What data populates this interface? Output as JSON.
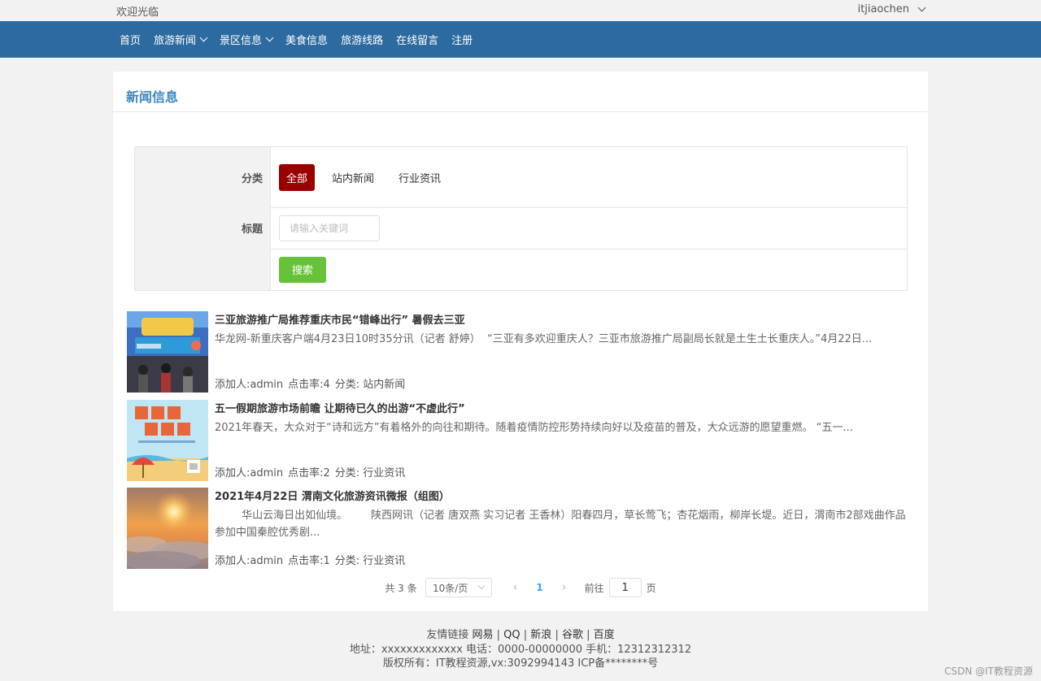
{
  "topbar": {
    "welcome": "欢迎光临",
    "username": "itjiaochen"
  },
  "nav": {
    "items": [
      {
        "label": "首页",
        "has_dropdown": false
      },
      {
        "label": "旅游新闻",
        "has_dropdown": true
      },
      {
        "label": "景区信息",
        "has_dropdown": true
      },
      {
        "label": "美食信息",
        "has_dropdown": false
      },
      {
        "label": "旅游线路",
        "has_dropdown": false
      },
      {
        "label": "在线留言",
        "has_dropdown": false
      },
      {
        "label": "注册",
        "has_dropdown": false
      }
    ]
  },
  "page": {
    "title": "新闻信息"
  },
  "filter": {
    "category_label": "分类",
    "categories": [
      "全部",
      "站内新闻",
      "行业资讯"
    ],
    "active_category": "全部",
    "title_label": "标题",
    "keyword_placeholder": "请输入关键词",
    "search_button": "搜索"
  },
  "news": [
    {
      "title": "三亚旅游推广局推荐重庆市民“错峰出行” 暑假去三亚",
      "summary": "华龙网-新重庆客户端4月23日10时35分讯（记者 舒婷）  “三亚有多欢迎重庆人？三亚市旅游推广局副局长就是土生土长重庆人。”4月22日...",
      "author": "添加人:admin",
      "clicks": "点击率:4",
      "category": "分类: 站内新闻",
      "thumb": "sanya-event"
    },
    {
      "title": "五一假期旅游市场前瞻 让期待已久的出游“不虚此行”",
      "summary": "2021年春天，大众对于“诗和远方”有着格外的向往和期待。随着疫情防控形势持续向好以及疫苗的普及，大众远游的愿望重燃。 “五一...",
      "author": "添加人:admin",
      "clicks": "点击率:2",
      "category": "分类: 行业资讯",
      "thumb": "may-day-beach"
    },
    {
      "title": "2021年4月22日 渭南文化旅游资讯微报（组图）",
      "summary": "        华山云海日出如仙境。       陕西网讯（记者 唐双燕 实习记者 王香林）阳春四月，草长莺飞；杏花烟雨，柳岸长堤。近日，渭南市2部戏曲作品参加中国秦腔优秀剧...",
      "author": "添加人:admin",
      "clicks": "点击率:1",
      "category": "分类: 行业资讯",
      "thumb": "sunrise-clouds"
    }
  ],
  "pagination": {
    "total": "共 3 条",
    "page_size": "10条/页",
    "current_page": "1",
    "goto_label": "前往",
    "goto_value": "1",
    "page_suffix": "页"
  },
  "footer": {
    "links_label": "友情链接",
    "links": [
      "网易",
      "QQ",
      "新浪",
      "谷歌",
      "百度"
    ],
    "address": "地址：xxxxxxxxxxxxx 电话：0000-00000000 手机：12312312312",
    "copyright": "版权所有：IT教程资源,vx:3092994143 ICP备********号"
  },
  "watermark": "CSDN @IT教程资源",
  "colors": {
    "nav_bg": "#2d6a9f",
    "accent_blue": "#3a86c0",
    "active_category": "#990000",
    "search_green": "#67c23a"
  }
}
